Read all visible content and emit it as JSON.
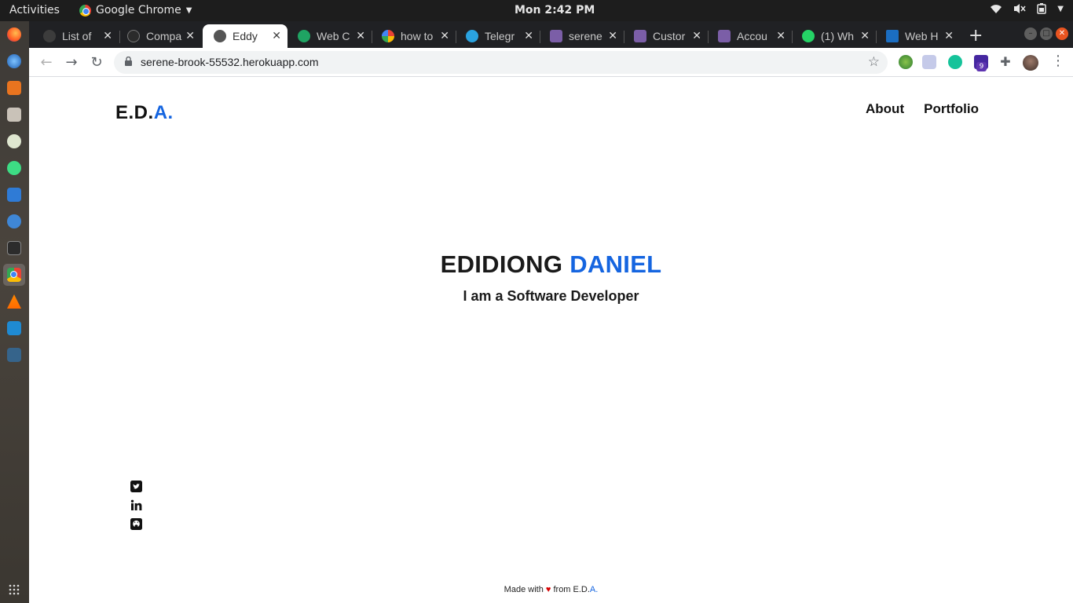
{
  "system": {
    "activities_label": "Activities",
    "app_name": "Google Chrome",
    "clock": "Mon  2:42 PM"
  },
  "dock": {
    "items": [
      "firefox-icon",
      "thunderbird-icon",
      "software-center-icon",
      "files-icon",
      "libreoffice-icon",
      "android-studio-icon",
      "writer-icon",
      "help-icon",
      "terminal-icon",
      "chrome-icon",
      "vlc-icon",
      "vscode-icon",
      "network-icon"
    ]
  },
  "browser": {
    "tabs": [
      {
        "label": "List of",
        "favicon_color": "#3c3c3c"
      },
      {
        "label": "Compa",
        "favicon_color": "#2b2b2b"
      },
      {
        "label": "Eddy",
        "favicon_color": "#555555",
        "active": true
      },
      {
        "label": "Web C",
        "favicon_color": "#1fa463"
      },
      {
        "label": "how to",
        "favicon_color": "#4285f4"
      },
      {
        "label": "Telegr",
        "favicon_color": "#2aa3e0"
      },
      {
        "label": "serene",
        "favicon_color": "#7b5ea7"
      },
      {
        "label": "Custor",
        "favicon_color": "#7b5ea7"
      },
      {
        "label": "Accou",
        "favicon_color": "#7b5ea7"
      },
      {
        "label": "(1) Wh",
        "favicon_color": "#25d366"
      },
      {
        "label": "Web H",
        "favicon_color": "#1b6ec2"
      }
    ],
    "url": "serene-brook-55532.herokuapp.com",
    "extension_badge": "9"
  },
  "page": {
    "logo_main": "E.D.",
    "logo_accent": "A.",
    "nav": {
      "about": "About",
      "portfolio": "Portfolio"
    },
    "hero": {
      "first_name": "EDIDIONG",
      "last_name": "DANIEL",
      "subtitle": "I am a Software Developer"
    },
    "social": [
      "twitter-icon",
      "linkedin-icon",
      "github-icon"
    ],
    "footer": {
      "made_with": "Made with",
      "heart": "♥",
      "from": "from E.D.",
      "accent": "A."
    },
    "colors": {
      "accent": "#1565e0",
      "heart": "#d50000"
    }
  }
}
